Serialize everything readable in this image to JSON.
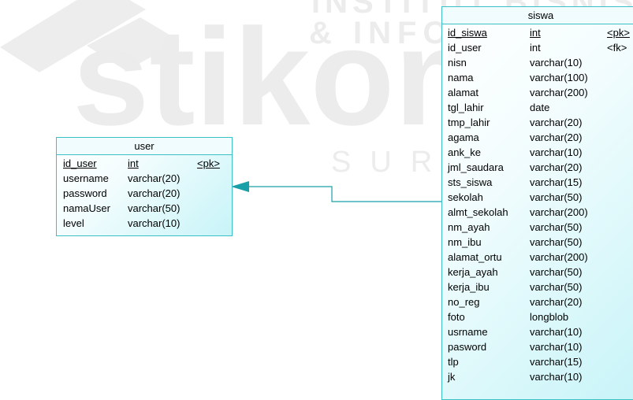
{
  "watermark": {
    "brand": "stikom",
    "line1": "INSTITUT BISNIS",
    "line2": "& INFORMATIKA",
    "city": "SURABAYA"
  },
  "colors": {
    "entity_border": "#3cc0c8",
    "entity_fill": "#c8f4f8",
    "connector": "#18a0a8",
    "watermark": "#ededed"
  },
  "relationship": {
    "from": "siswa",
    "to": "user",
    "arrow_icon": "arrow-left-icon"
  },
  "tables": {
    "user": {
      "name": "user",
      "columns": [
        {
          "name": "id_user",
          "type": "int",
          "key": "<pk>"
        },
        {
          "name": "username",
          "type": "varchar(20)",
          "key": ""
        },
        {
          "name": "password",
          "type": "varchar(20)",
          "key": ""
        },
        {
          "name": "namaUser",
          "type": "varchar(50)",
          "key": ""
        },
        {
          "name": "level",
          "type": "varchar(10)",
          "key": ""
        }
      ]
    },
    "siswa": {
      "name": "siswa",
      "columns": [
        {
          "name": "id_siswa",
          "type": "int",
          "key": "<pk>"
        },
        {
          "name": "id_user",
          "type": "int",
          "key": "<fk>"
        },
        {
          "name": "nisn",
          "type": "varchar(10)",
          "key": ""
        },
        {
          "name": "nama",
          "type": "varchar(100)",
          "key": ""
        },
        {
          "name": "alamat",
          "type": "varchar(200)",
          "key": ""
        },
        {
          "name": "tgl_lahir",
          "type": "date",
          "key": ""
        },
        {
          "name": "tmp_lahir",
          "type": "varchar(20)",
          "key": ""
        },
        {
          "name": "agama",
          "type": "varchar(20)",
          "key": ""
        },
        {
          "name": "ank_ke",
          "type": "varchar(10)",
          "key": ""
        },
        {
          "name": "jml_saudara",
          "type": "varchar(20)",
          "key": ""
        },
        {
          "name": "sts_siswa",
          "type": "varchar(15)",
          "key": ""
        },
        {
          "name": "sekolah",
          "type": "varchar(50)",
          "key": ""
        },
        {
          "name": "almt_sekolah",
          "type": "varchar(200)",
          "key": ""
        },
        {
          "name": "nm_ayah",
          "type": "varchar(50)",
          "key": ""
        },
        {
          "name": "nm_ibu",
          "type": "varchar(50)",
          "key": ""
        },
        {
          "name": "alamat_ortu",
          "type": "varchar(200)",
          "key": ""
        },
        {
          "name": "kerja_ayah",
          "type": "varchar(50)",
          "key": ""
        },
        {
          "name": "kerja_ibu",
          "type": "varchar(50)",
          "key": ""
        },
        {
          "name": "no_reg",
          "type": "varchar(20)",
          "key": ""
        },
        {
          "name": "foto",
          "type": "longblob",
          "key": ""
        },
        {
          "name": "usrname",
          "type": "varchar(10)",
          "key": ""
        },
        {
          "name": "pasword",
          "type": "varchar(10)",
          "key": ""
        },
        {
          "name": "tlp",
          "type": "varchar(15)",
          "key": ""
        },
        {
          "name": "jk",
          "type": "varchar(10)",
          "key": ""
        }
      ]
    }
  }
}
